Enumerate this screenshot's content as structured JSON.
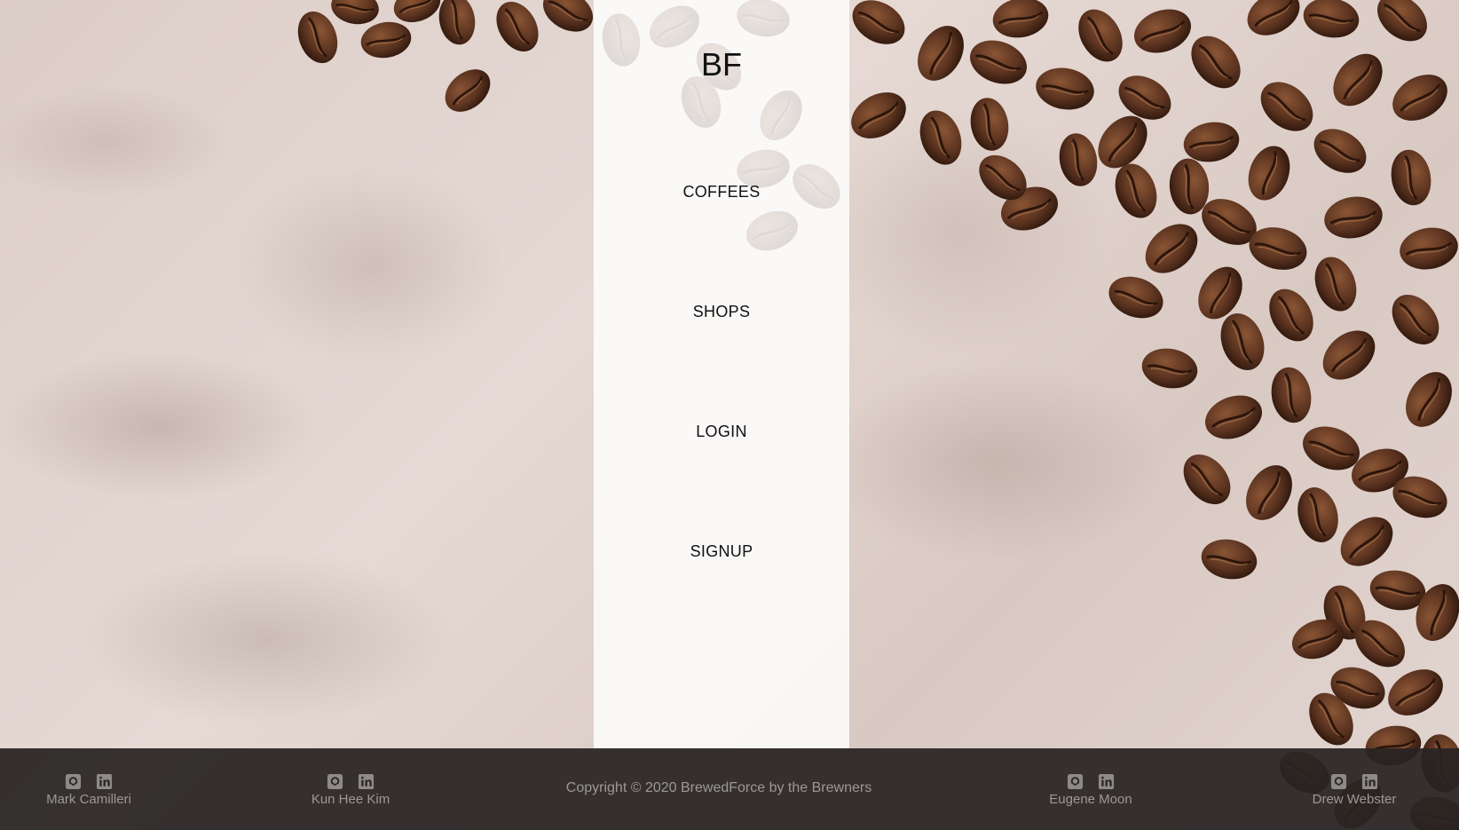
{
  "nav": {
    "logo": "BF",
    "items": [
      {
        "label": "COFFEES"
      },
      {
        "label": "SHOPS"
      },
      {
        "label": "LOGIN"
      },
      {
        "label": "SIGNUP"
      }
    ]
  },
  "footer": {
    "copyright": "Copyright © 2020 BrewedForce by the Brewners",
    "members": [
      {
        "name": "Mark Camilleri",
        "icons": [
          "github-icon",
          "linkedin-icon"
        ]
      },
      {
        "name": "Kun Hee Kim",
        "icons": [
          "github-icon",
          "linkedin-icon"
        ]
      },
      {
        "name": "Eugene Moon",
        "icons": [
          "github-icon",
          "linkedin-icon"
        ]
      },
      {
        "name": "Drew Webster",
        "icons": [
          "github-icon",
          "linkedin-icon"
        ]
      }
    ]
  },
  "colors": {
    "background": "#e3d6d1",
    "bean": "#5b3320",
    "panel": "#ffffff",
    "footer": "#282422",
    "footer_text": "#9c9896"
  }
}
